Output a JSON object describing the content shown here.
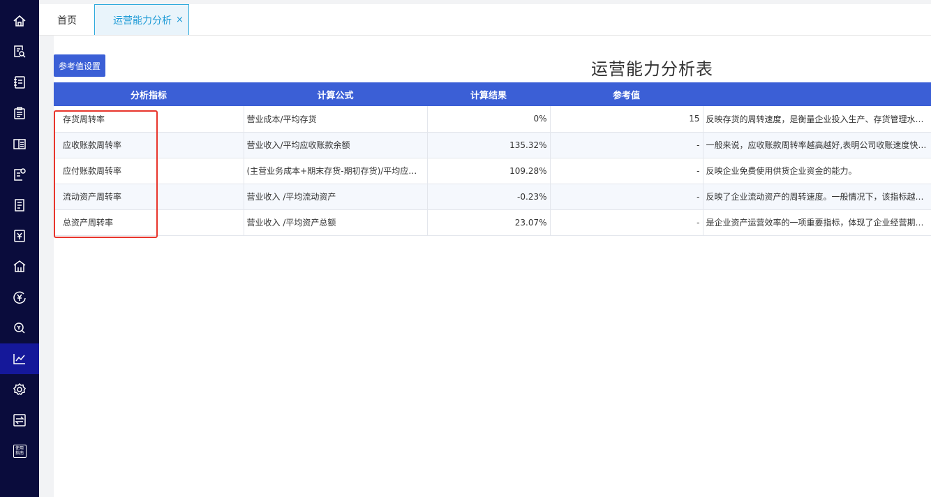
{
  "sidebar": {
    "items": [
      {
        "icon": "home-icon"
      },
      {
        "icon": "document-search-icon"
      },
      {
        "icon": "ledger-icon"
      },
      {
        "icon": "clipboard-icon"
      },
      {
        "icon": "book-icon"
      },
      {
        "icon": "invoice-icon"
      },
      {
        "icon": "report-icon"
      },
      {
        "icon": "yen-document-icon"
      },
      {
        "icon": "bank-icon"
      },
      {
        "icon": "yen-circle-icon"
      },
      {
        "icon": "money-search-icon"
      },
      {
        "icon": "chart-line-icon",
        "active": true
      },
      {
        "icon": "gear-icon"
      },
      {
        "icon": "transfer-icon"
      },
      {
        "icon": "guide-icon",
        "text_top": "使用",
        "text_bottom": "指南"
      }
    ],
    "background": "#0a0c3c",
    "active_color": "#15189a"
  },
  "tabs": {
    "home": "首页",
    "active": "运营能力分析",
    "close": "×"
  },
  "toolbar": {
    "ref_button": "参考值设置"
  },
  "page_title": "运营能力分析表",
  "table": {
    "headers": [
      "分析指标",
      "计算公式",
      "计算结果",
      "参考值",
      ""
    ],
    "rows": [
      {
        "name": "存货周转率",
        "formula": "营业成本/平均存货",
        "result": "0%",
        "ref": "15",
        "desc": "反映存货的周转速度，是衡量企业投入生产、存货管理水平、"
      },
      {
        "name": "应收账款周转率",
        "formula": "营业收入/平均应收账款余额",
        "result": "135.32%",
        "ref": "-",
        "desc": "一般来说，应收账款周转率越高越好,表明公司收账速度快，平"
      },
      {
        "name": "应付账款周转率",
        "formula": "(主营业务成本+期末存货-期初存货)/平均应付账款",
        "result": "109.28%",
        "ref": "-",
        "desc": "反映企业免费使用供货企业资金的能力。"
      },
      {
        "name": "流动资产周转率",
        "formula": "营业收入 /平均流动资产",
        "result": "-0.23%",
        "ref": "-",
        "desc": "反映了企业流动资产的周转速度。一般情况下，该指标越高，"
      },
      {
        "name": "总资产周转率",
        "formula": "营业收入 /平均资产总额",
        "result": "23.07%",
        "ref": "-",
        "desc": "是企业资产运营效率的一项重要指标，体现了企业经营期间全"
      }
    ],
    "header_color": "#3b5fd6"
  },
  "highlight_color": "#e8352c"
}
